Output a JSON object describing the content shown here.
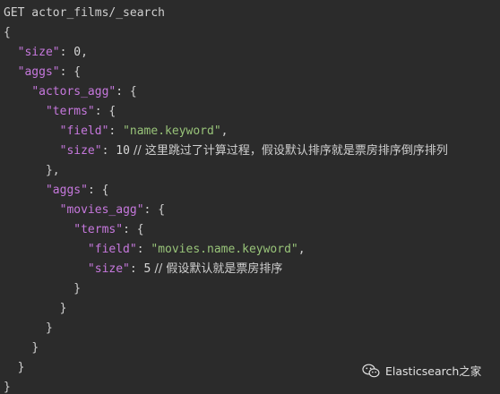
{
  "colors": {
    "background": "#2b2b2b",
    "key": "#c678dd",
    "string": "#98c379",
    "punct": "#cfcfcf"
  },
  "code": {
    "l1": {
      "request": "GET actor_films/_search"
    },
    "l2": {
      "p": "{"
    },
    "l3": {
      "k": "\"size\"",
      "p": ": ",
      "v": "0",
      "e": ","
    },
    "l4": {
      "k": "\"aggs\"",
      "p": ": {"
    },
    "l5": {
      "k": "\"actors_agg\"",
      "p": ": {"
    },
    "l6": {
      "k": "\"terms\"",
      "p": ": {"
    },
    "l7": {
      "k": "\"field\"",
      "p": ": ",
      "s": "\"name.keyword\"",
      "e": ","
    },
    "l8": {
      "k": "\"size\"",
      "p": ": ",
      "v": "10",
      "c": " // 这里跳过了计算过程，假设默认排序就是票房排序倒序排列"
    },
    "l9": {
      "p": "},"
    },
    "l10": {
      "k": "\"aggs\"",
      "p": ": {"
    },
    "l11": {
      "k": "\"movies_agg\"",
      "p": ": {"
    },
    "l12": {
      "k": "\"terms\"",
      "p": ": {"
    },
    "l13": {
      "k": "\"field\"",
      "p": ": ",
      "s": "\"movies.name.keyword\"",
      "e": ","
    },
    "l14": {
      "k": "\"size\"",
      "p": ": ",
      "v": "5",
      "c": " // 假设默认就是票房排序"
    },
    "l15": {
      "p": "}"
    },
    "l16": {
      "p": "}"
    },
    "l17": {
      "p": "}"
    },
    "l18": {
      "p": "}"
    },
    "l19": {
      "p": "}"
    },
    "l20": {
      "p": "}"
    }
  },
  "watermark": {
    "icon": "wechat-icon",
    "text": "Elasticsearch之家"
  }
}
